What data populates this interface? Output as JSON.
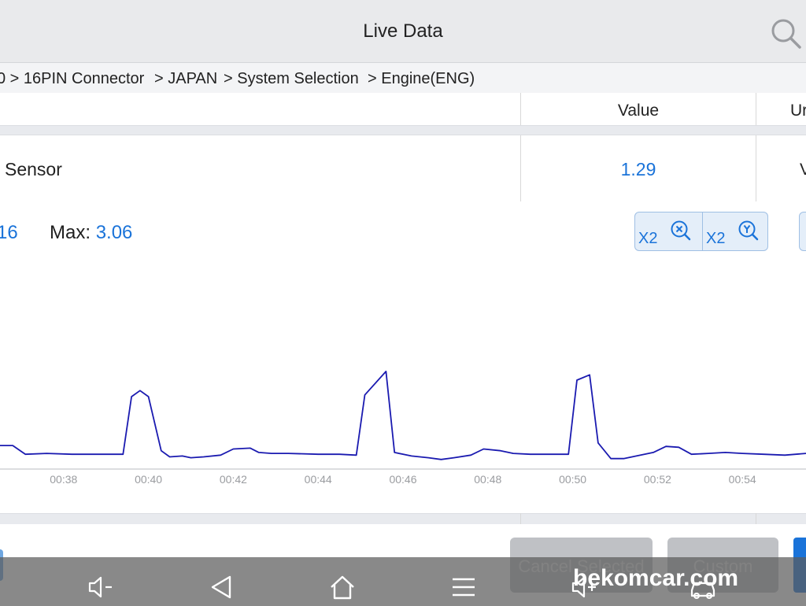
{
  "header": {
    "title": "Live Data",
    "search_icon": "search-icon"
  },
  "breadcrumb": [
    "0 > 16PIN Connector",
    "> JAPAN",
    "> System Selection",
    "> Engine(ENG)"
  ],
  "table": {
    "columns": {
      "value": "Value",
      "unit": "Ur"
    },
    "row": {
      "name": "Sensor",
      "value": "1.29",
      "unit": "V"
    }
  },
  "stats": {
    "min_label": "",
    "min_value": "16",
    "max_label": "Max:",
    "max_value": "3.06"
  },
  "zoom": {
    "x_label": "X2",
    "y_label": "X2"
  },
  "chart_data": {
    "type": "line",
    "x_ticks": [
      "00:38",
      "00:40",
      "00:42",
      "00:44",
      "00:46",
      "00:48",
      "00:50",
      "00:52",
      "00:54"
    ],
    "x_range_sec": [
      36.5,
      55.5
    ],
    "y_range": [
      0.95,
      3.35
    ],
    "line_color": "#1a1ab0",
    "series": [
      {
        "name": "",
        "points": [
          [
            36.5,
            1.22
          ],
          [
            36.8,
            1.22
          ],
          [
            37.1,
            1.12
          ],
          [
            37.6,
            1.13
          ],
          [
            38.2,
            1.12
          ],
          [
            39.0,
            1.12
          ],
          [
            39.4,
            1.12
          ],
          [
            39.6,
            1.78
          ],
          [
            39.8,
            1.85
          ],
          [
            40.0,
            1.78
          ],
          [
            40.3,
            1.16
          ],
          [
            40.5,
            1.09
          ],
          [
            40.8,
            1.1
          ],
          [
            41.0,
            1.08
          ],
          [
            41.3,
            1.09
          ],
          [
            41.7,
            1.11
          ],
          [
            42.0,
            1.18
          ],
          [
            42.4,
            1.19
          ],
          [
            42.6,
            1.14
          ],
          [
            42.9,
            1.13
          ],
          [
            43.3,
            1.13
          ],
          [
            44.0,
            1.12
          ],
          [
            44.5,
            1.12
          ],
          [
            44.9,
            1.11
          ],
          [
            45.1,
            1.8
          ],
          [
            45.6,
            2.07
          ],
          [
            45.8,
            1.14
          ],
          [
            46.2,
            1.1
          ],
          [
            46.6,
            1.08
          ],
          [
            46.9,
            1.06
          ],
          [
            47.2,
            1.08
          ],
          [
            47.6,
            1.11
          ],
          [
            47.9,
            1.18
          ],
          [
            48.3,
            1.16
          ],
          [
            48.6,
            1.13
          ],
          [
            49.0,
            1.12
          ],
          [
            49.5,
            1.12
          ],
          [
            49.9,
            1.12
          ],
          [
            50.1,
            1.97
          ],
          [
            50.4,
            2.03
          ],
          [
            50.6,
            1.25
          ],
          [
            50.9,
            1.07
          ],
          [
            51.2,
            1.07
          ],
          [
            51.5,
            1.1
          ],
          [
            51.9,
            1.14
          ],
          [
            52.2,
            1.21
          ],
          [
            52.5,
            1.2
          ],
          [
            52.8,
            1.12
          ],
          [
            53.2,
            1.13
          ],
          [
            53.6,
            1.14
          ],
          [
            54.0,
            1.13
          ],
          [
            54.5,
            1.12
          ],
          [
            55.0,
            1.11
          ],
          [
            55.5,
            1.13
          ]
        ]
      }
    ]
  },
  "buttons": {
    "cancel_selected": "Cancel Selected",
    "custom": "Custom"
  },
  "navbar": {
    "icons": [
      "volume-down-icon",
      "back-icon",
      "home-icon",
      "menu-icon",
      "volume-up-icon",
      "car-icon"
    ]
  },
  "watermark": "bekomcar.com"
}
